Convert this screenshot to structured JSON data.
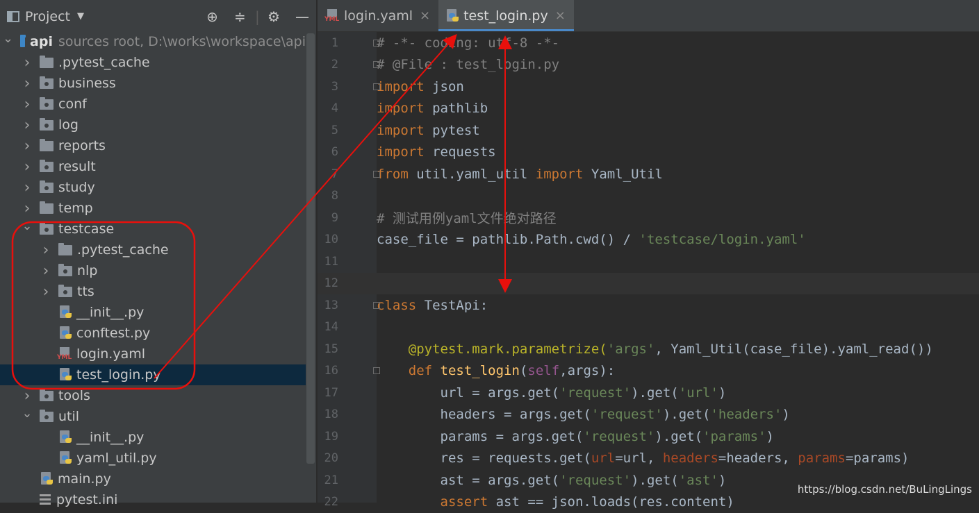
{
  "sidebar": {
    "title": "Project",
    "tree": [
      {
        "indent": 0,
        "arrow": "down",
        "icon": "root",
        "label": "api",
        "bold": true,
        "suffix": "sources root,  D:\\works\\workspace\\api"
      },
      {
        "indent": 1,
        "arrow": "right",
        "icon": "folder",
        "label": ".pytest_cache"
      },
      {
        "indent": 1,
        "arrow": "right",
        "icon": "pkg",
        "label": "business"
      },
      {
        "indent": 1,
        "arrow": "right",
        "icon": "pkg",
        "label": "conf"
      },
      {
        "indent": 1,
        "arrow": "right",
        "icon": "pkg",
        "label": "log"
      },
      {
        "indent": 1,
        "arrow": "right",
        "icon": "folder",
        "label": "reports"
      },
      {
        "indent": 1,
        "arrow": "right",
        "icon": "pkg",
        "label": "result"
      },
      {
        "indent": 1,
        "arrow": "right",
        "icon": "pkg",
        "label": "study"
      },
      {
        "indent": 1,
        "arrow": "right",
        "icon": "folder",
        "label": "temp"
      },
      {
        "indent": 1,
        "arrow": "down",
        "icon": "pkg",
        "label": "testcase"
      },
      {
        "indent": 2,
        "arrow": "right",
        "icon": "folder",
        "label": ".pytest_cache"
      },
      {
        "indent": 2,
        "arrow": "right",
        "icon": "pkg",
        "label": "nlp"
      },
      {
        "indent": 2,
        "arrow": "right",
        "icon": "pkg",
        "label": "tts"
      },
      {
        "indent": 2,
        "arrow": "none",
        "icon": "py",
        "label": "__init__.py"
      },
      {
        "indent": 2,
        "arrow": "none",
        "icon": "py",
        "label": "conftest.py"
      },
      {
        "indent": 2,
        "arrow": "none",
        "icon": "yml",
        "label": "login.yaml"
      },
      {
        "indent": 2,
        "arrow": "none",
        "icon": "py",
        "label": "test_login.py",
        "selected": true
      },
      {
        "indent": 1,
        "arrow": "right",
        "icon": "pkg",
        "label": "tools"
      },
      {
        "indent": 1,
        "arrow": "down",
        "icon": "pkg",
        "label": "util"
      },
      {
        "indent": 2,
        "arrow": "none",
        "icon": "py",
        "label": "__init__.py"
      },
      {
        "indent": 2,
        "arrow": "none",
        "icon": "py",
        "label": "yaml_util.py"
      },
      {
        "indent": 1,
        "arrow": "none",
        "icon": "py",
        "label": "main.py"
      },
      {
        "indent": 1,
        "arrow": "none",
        "icon": "list",
        "label": "pytest.ini"
      }
    ]
  },
  "tabs": [
    {
      "label": "login.yaml",
      "icon": "yml",
      "active": false
    },
    {
      "label": "test_login.py",
      "icon": "py",
      "active": true
    }
  ],
  "icon_labels": {
    "yml": "YML"
  },
  "code": [
    {
      "n": "1",
      "fold": true,
      "tokens": [
        [
          "cm",
          "# -*- coding: utf-8 -*-"
        ]
      ]
    },
    {
      "n": "2",
      "fold": true,
      "tokens": [
        [
          "cm",
          "# @File : test_login.py"
        ]
      ]
    },
    {
      "n": "3",
      "fold": true,
      "tokens": [
        [
          "kw",
          "import"
        ],
        [
          "code",
          " json"
        ]
      ]
    },
    {
      "n": "4",
      "tokens": [
        [
          "kw",
          "import"
        ],
        [
          "code",
          " pathlib"
        ]
      ]
    },
    {
      "n": "5",
      "tokens": [
        [
          "kw",
          "import"
        ],
        [
          "code",
          " pytest"
        ]
      ]
    },
    {
      "n": "6",
      "tokens": [
        [
          "kw",
          "import"
        ],
        [
          "code",
          " requests"
        ]
      ]
    },
    {
      "n": "7",
      "fold": true,
      "tokens": [
        [
          "kw",
          "from"
        ],
        [
          "code",
          " util.yaml_util "
        ],
        [
          "kw",
          "import"
        ],
        [
          "code",
          " Yaml_Util"
        ]
      ]
    },
    {
      "n": "8",
      "tokens": []
    },
    {
      "n": "9",
      "tokens": [
        [
          "cm",
          "# 测试用例yaml文件绝对路径"
        ]
      ]
    },
    {
      "n": "10",
      "tokens": [
        [
          "code",
          "case_file = pathlib.Path.cwd() / "
        ],
        [
          "st",
          "'testcase/login.yaml'"
        ]
      ]
    },
    {
      "n": "11",
      "tokens": []
    },
    {
      "n": "12",
      "current": true,
      "tokens": []
    },
    {
      "n": "13",
      "fold": true,
      "tokens": [
        [
          "kw",
          "class"
        ],
        [
          "code",
          " TestApi:"
        ]
      ]
    },
    {
      "n": "14",
      "tokens": []
    },
    {
      "n": "15",
      "tokens": [
        [
          "code",
          "    "
        ],
        [
          "dec",
          "@pytest.mark.parametrize("
        ],
        [
          "st",
          "'args'"
        ],
        [
          "code",
          ", Yaml_Util(case_file).yaml_read())"
        ]
      ]
    },
    {
      "n": "16",
      "fold": true,
      "tokens": [
        [
          "code",
          "    "
        ],
        [
          "kw",
          "def"
        ],
        [
          "code",
          " "
        ],
        [
          "fn",
          "test_login"
        ],
        [
          "code",
          "("
        ],
        [
          "sf",
          "self"
        ],
        [
          "code",
          ",args):"
        ]
      ]
    },
    {
      "n": "17",
      "tokens": [
        [
          "code",
          "        url = args.get("
        ],
        [
          "st",
          "'request'"
        ],
        [
          "code",
          ").get("
        ],
        [
          "st",
          "'url'"
        ],
        [
          "code",
          ")"
        ]
      ]
    },
    {
      "n": "18",
      "tokens": [
        [
          "code",
          "        headers = args.get("
        ],
        [
          "st",
          "'request'"
        ],
        [
          "code",
          ").get("
        ],
        [
          "st",
          "'headers'"
        ],
        [
          "code",
          ")"
        ]
      ]
    },
    {
      "n": "19",
      "tokens": [
        [
          "code",
          "        params = args.get("
        ],
        [
          "st",
          "'request'"
        ],
        [
          "code",
          ").get("
        ],
        [
          "st",
          "'params'"
        ],
        [
          "code",
          ")"
        ]
      ]
    },
    {
      "n": "20",
      "tokens": [
        [
          "code",
          "        res = requests.get("
        ],
        [
          "pk",
          "url"
        ],
        [
          "code",
          "=url, "
        ],
        [
          "pk",
          "headers"
        ],
        [
          "code",
          "=headers, "
        ],
        [
          "pk",
          "params"
        ],
        [
          "code",
          "=params)"
        ]
      ]
    },
    {
      "n": "21",
      "tokens": [
        [
          "code",
          "        ast = args.get("
        ],
        [
          "st",
          "'request'"
        ],
        [
          "code",
          ").get("
        ],
        [
          "st",
          "'ast'"
        ],
        [
          "code",
          ")"
        ]
      ]
    },
    {
      "n": "22",
      "tokens": [
        [
          "kw",
          "        assert"
        ],
        [
          "code",
          " ast == json.loads(res.content)"
        ]
      ]
    }
  ],
  "watermark": "https://blog.csdn.net/BuLingLings",
  "colors": {
    "annotation": "#e8100c",
    "selection": "#0d293e",
    "tab_underline": "#4a88c7"
  }
}
